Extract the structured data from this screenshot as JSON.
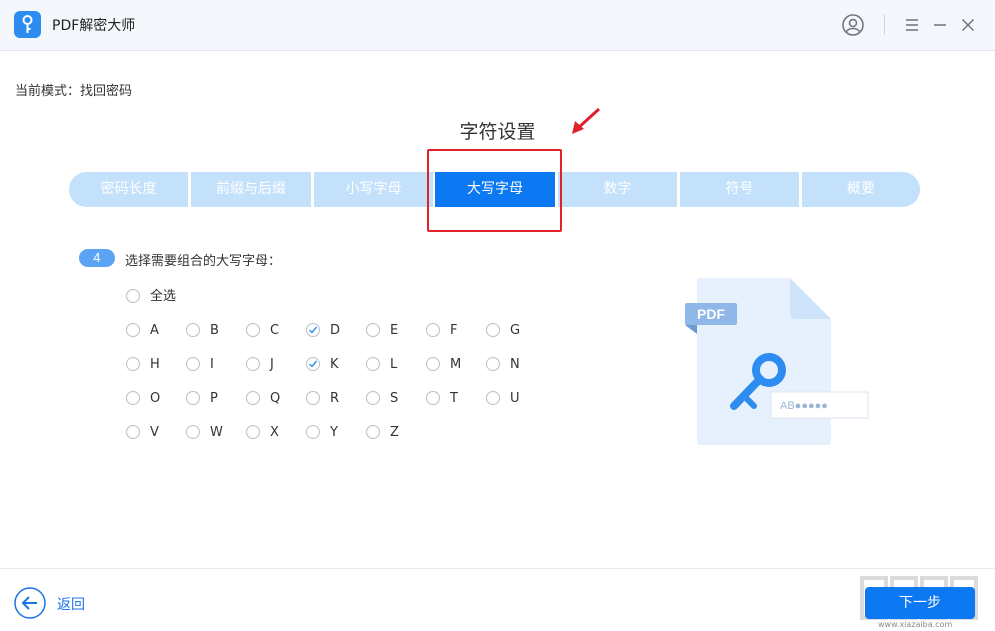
{
  "titlebar": {
    "title": "PDF解密大师",
    "icons": [
      "key-icon",
      "user-icon",
      "menu-icon",
      "minimize-icon",
      "close-icon"
    ]
  },
  "mode": {
    "label": "当前模式：找回密码"
  },
  "section": {
    "title": "字符设置"
  },
  "tabs": [
    {
      "label": "密码长度",
      "active": false
    },
    {
      "label": "前缀与后缀",
      "active": false
    },
    {
      "label": "小写字母",
      "active": false
    },
    {
      "label": "大写字母",
      "active": true
    },
    {
      "label": "数字",
      "active": false
    },
    {
      "label": "符号",
      "active": false
    },
    {
      "label": "概要",
      "active": false
    }
  ],
  "step": {
    "number": "4",
    "text": "选择需要组合的大写字母："
  },
  "select_all": {
    "label": "全选",
    "checked": false
  },
  "letters": [
    {
      "label": "A",
      "checked": false
    },
    {
      "label": "B",
      "checked": false
    },
    {
      "label": "C",
      "checked": false
    },
    {
      "label": "D",
      "checked": true
    },
    {
      "label": "E",
      "checked": false
    },
    {
      "label": "F",
      "checked": false
    },
    {
      "label": "G",
      "checked": false
    },
    {
      "label": "H",
      "checked": false
    },
    {
      "label": "I",
      "checked": false
    },
    {
      "label": "J",
      "checked": false
    },
    {
      "label": "K",
      "checked": true
    },
    {
      "label": "L",
      "checked": false
    },
    {
      "label": "M",
      "checked": false
    },
    {
      "label": "N",
      "checked": false
    },
    {
      "label": "O",
      "checked": false
    },
    {
      "label": "P",
      "checked": false
    },
    {
      "label": "Q",
      "checked": false
    },
    {
      "label": "R",
      "checked": false
    },
    {
      "label": "S",
      "checked": false
    },
    {
      "label": "T",
      "checked": false
    },
    {
      "label": "U",
      "checked": false
    },
    {
      "label": "V",
      "checked": false
    },
    {
      "label": "W",
      "checked": false
    },
    {
      "label": "X",
      "checked": false
    },
    {
      "label": "Y",
      "checked": false
    },
    {
      "label": "Z",
      "checked": false
    }
  ],
  "illustration": {
    "pdf_badge": "PDF",
    "password_hint": "AB●●●●●"
  },
  "footer": {
    "back_label": "返回",
    "next_label": "下一步"
  },
  "watermark": {
    "text": "www.xiazaiba.com"
  },
  "colors": {
    "accent": "#0c79f2",
    "tab_bg": "#c3e1fb",
    "highlight": "#e0232a",
    "badge": "#5aa3f5"
  }
}
